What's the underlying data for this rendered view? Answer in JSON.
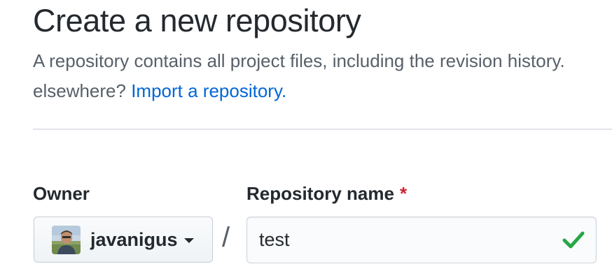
{
  "header": {
    "title": "Create a new repository",
    "description_line1": "A repository contains all project files, including the revision history.",
    "description_line2_prefix": "elsewhere? ",
    "import_link": "Import a repository."
  },
  "form": {
    "owner": {
      "label": "Owner",
      "selected": "javanigus"
    },
    "separator": "/",
    "repository_name": {
      "label": "Repository name",
      "required_marker": "*",
      "value": "test",
      "status_icon": "checkmark-icon"
    }
  },
  "colors": {
    "link": "#0366d6",
    "required": "#cb2431",
    "success": "#28a745",
    "text": "#24292e",
    "muted": "#586069"
  }
}
